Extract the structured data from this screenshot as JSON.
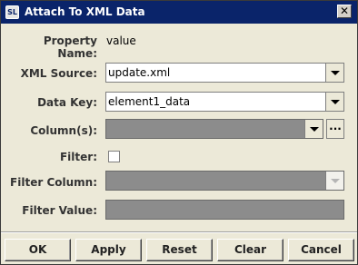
{
  "window": {
    "title": "Attach To XML Data",
    "logo_text": "SL",
    "close_glyph": "✕"
  },
  "form": {
    "property_name": {
      "label": "Property Name:",
      "value": "value"
    },
    "xml_source": {
      "label": "XML Source:",
      "value": "update.xml"
    },
    "data_key": {
      "label": "Data Key:",
      "value": "element1_data"
    },
    "columns": {
      "label": "Column(s):",
      "value": "",
      "browse_label": "..."
    },
    "filter": {
      "label": "Filter:",
      "checked": false
    },
    "filter_column": {
      "label": "Filter Column:",
      "value": ""
    },
    "filter_value": {
      "label": "Filter Value:",
      "value": ""
    }
  },
  "buttons": {
    "ok": "OK",
    "apply": "Apply",
    "reset": "Reset",
    "clear": "Clear",
    "cancel": "Cancel"
  },
  "colors": {
    "titlebar": "#0a246a",
    "dialog_bg": "#ece9d8",
    "disabled_field": "#8c8c8c"
  }
}
